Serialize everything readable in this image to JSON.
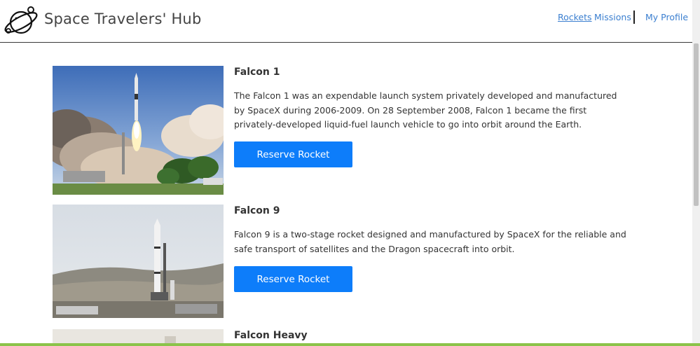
{
  "header": {
    "brand": "Space Travelers' Hub",
    "logo_icon": "planet-logo-icon",
    "nav": [
      {
        "label": "Rockets",
        "active": true
      },
      {
        "label": "Missions",
        "active": false
      },
      {
        "label": "My Profile",
        "active": false
      }
    ]
  },
  "rockets": [
    {
      "name": "Falcon 1",
      "description": "The Falcon 1 was an expendable launch system privately developed and manufactured by SpaceX during 2006-2009. On 28 September 2008, Falcon 1 became the first privately-developed liquid-fuel launch vehicle to go into orbit around the Earth.",
      "button_label": "Reserve Rocket",
      "image": "falcon-1-launch-photo"
    },
    {
      "name": "Falcon 9",
      "description": "Falcon 9 is a two-stage rocket designed and manufactured by SpaceX for the reliable and safe transport of satellites and the Dragon spacecraft into orbit.",
      "button_label": "Reserve Rocket",
      "image": "falcon-9-pad-photo"
    },
    {
      "name": "Falcon Heavy",
      "image": "falcon-heavy-photo"
    }
  ],
  "colors": {
    "button": "#0d7dfa",
    "nav_link": "#3b7fd0",
    "text": "#333333"
  }
}
